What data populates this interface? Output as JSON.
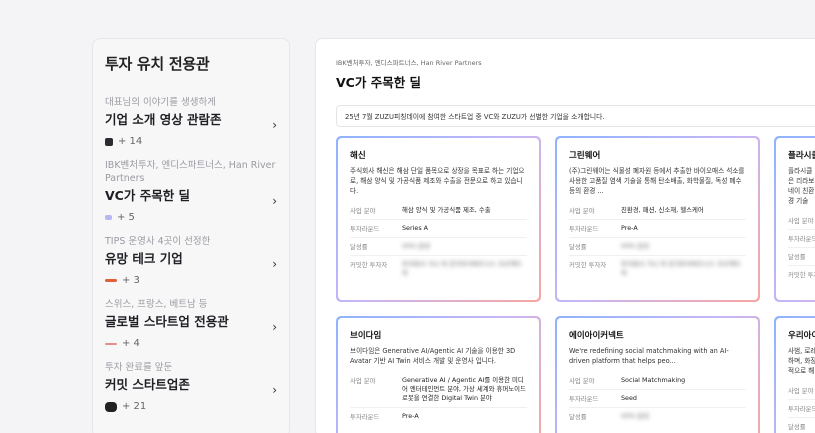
{
  "sidebar": {
    "title": "투자 유치 전용관",
    "items": [
      {
        "sub": "대표님의 이야기를 생생하게",
        "main": "기업 소개 영상 관람존",
        "count": "+ 14",
        "logo_color": "#2b2b30"
      },
      {
        "sub": "IBK벤처투자, 엔디스파트너스, Han River Partners",
        "main": "VC가 주목한 딜",
        "count": "+ 5",
        "logo_color": "#b6b9f0"
      },
      {
        "sub": "TIPS 운영사 4곳이 선정한",
        "main": "유망 테크 기업",
        "count": "+ 3",
        "logo_color": "#e0603c"
      },
      {
        "sub": "스위스, 프랑스, 베트남 등",
        "main": "글로벌 스타트업 전용관",
        "count": "+ 4",
        "logo_color": "#e88b8b"
      },
      {
        "sub": "투자 완료를 앞둔",
        "main": "커밋 스타트업존",
        "count": "+ 21",
        "logo_color": "#222"
      }
    ]
  },
  "main": {
    "breadcrumb": "IBK벤처투자, 엔디스파트너스, Han River Partners",
    "title": "VC가 주목한 딜",
    "notice": "25년 7월 ZUZU피칭데이에 참여한 스타트업 중 VC와 ZUZU가 선별한 기업을 소개합니다.",
    "labels": {
      "field": "사업 분야",
      "round": "투자라운드",
      "rate": "달성률",
      "investor": "커밋한 투자자"
    },
    "cards": [
      {
        "name": "해신",
        "desc": "주식회사 해신은 해삼 단일 품목으로 상장을 목표로 하는 기업으로, 해삼 양식 및 가공식품 제조와 수출을 전문으로 하고 있습니다.",
        "field": "해삼 양식 및 가공식품 제조, 수출",
        "round": "Series A",
        "rate": "00% 달성",
        "investor": "투자회사 가나 외 한국투자파트너스 프로젝트 외"
      },
      {
        "name": "그린웨어",
        "desc": "(주)그린웨어는 식물성 폐자원 등에서 추출한 바이오매스 석소를 사용한 고품질 염색 기술을 통해 탄소배출, 화학물질, 독성 폐수 등의 환경 ...",
        "field": "친환경, 패션, 신소재, 헬스케어",
        "round": "Pre-A",
        "rate": "00% 달성",
        "investor": "투자회사 가나 외 한국투자파트너스 프로젝트 외"
      },
      {
        "name": "플라시클",
        "desc": "플라시클은 리라보네이 친환경 기술",
        "field": "",
        "round": "",
        "rate": "",
        "investor": ""
      },
      {
        "name": "브이다임",
        "desc": "브이다임은 Generative AI/Agentic AI 기술을 이용한 3D Avatar 기반 AI Twin 서비스 개발 및 운영사 입니다.",
        "field": "Generative AI / Agentic AI를 이용한 미디어 엔터테인먼트 분야, 가상 세계와 휴머노이드 로봇을 연결한 Digital Twin 분야",
        "round": "Pre-A",
        "rate": "",
        "investor": ""
      },
      {
        "name": "에이아이커넥트",
        "desc": "We're redefining social matchmaking with an AI-driven platform that helps peo...",
        "field": "Social Matchmaking",
        "round": "Seed",
        "rate": "00% 달성",
        "investor": ""
      },
      {
        "name": "우리아이",
        "desc": "사범, 로레 하며, 화장 적으로 해",
        "field": "",
        "round": "",
        "rate": "",
        "investor": ""
      }
    ]
  }
}
